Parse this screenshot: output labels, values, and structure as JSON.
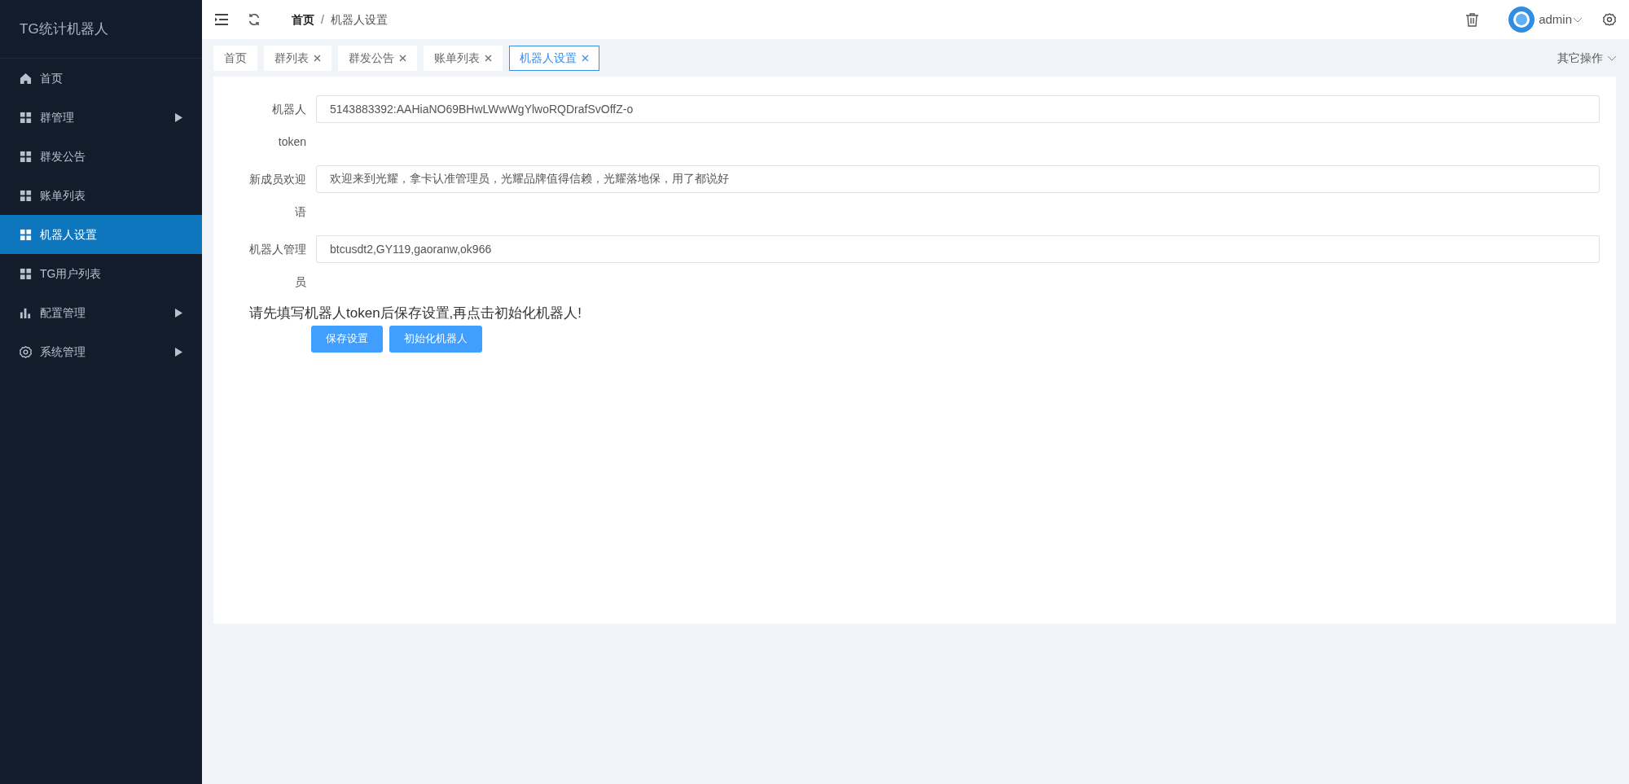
{
  "sidebar": {
    "title": "TG统计机器人",
    "items": [
      {
        "label": "首页",
        "kind": "home",
        "selected": false,
        "has_submenu": false
      },
      {
        "label": "群管理",
        "kind": "grid",
        "selected": false,
        "has_submenu": true
      },
      {
        "label": "群发公告",
        "kind": "grid",
        "selected": false,
        "has_submenu": false
      },
      {
        "label": "账单列表",
        "kind": "grid",
        "selected": false,
        "has_submenu": false
      },
      {
        "label": "机器人设置",
        "kind": "grid",
        "selected": true,
        "has_submenu": false
      },
      {
        "label": "TG用户列表",
        "kind": "grid",
        "selected": false,
        "has_submenu": false
      },
      {
        "label": "配置管理",
        "kind": "chart",
        "selected": false,
        "has_submenu": true
      },
      {
        "label": "系统管理",
        "kind": "gear",
        "selected": false,
        "has_submenu": true
      }
    ]
  },
  "header": {
    "breadcrumb": [
      "首页",
      "机器人设置"
    ],
    "breadcrumb_separator": "/",
    "user": "admin"
  },
  "tabs": [
    {
      "label": "首页",
      "closable": false,
      "selected": false
    },
    {
      "label": "群列表",
      "closable": true,
      "selected": false
    },
    {
      "label": "群发公告",
      "closable": true,
      "selected": false
    },
    {
      "label": "账单列表",
      "closable": true,
      "selected": false
    },
    {
      "label": "机器人设置",
      "closable": true,
      "selected": true
    }
  ],
  "tab_actions": "其它操作",
  "form": {
    "fields": [
      {
        "label": "机器人token",
        "value": "5143883392:AAHiaNO69BHwLWwWgYlwoRQDrafSvOffZ-o"
      },
      {
        "label": "新成员欢迎语",
        "value": "欢迎来到光耀，拿卡认准管理员，光耀品牌值得信赖，光耀落地保，用了都说好"
      },
      {
        "label": "机器人管理员",
        "value": "btcusdt2,GY119,gaoranw,ok966"
      }
    ],
    "notice": "请先填写机器人token后保存设置,再点击初始化机器人!",
    "buttons": [
      "保存设置",
      "初始化机器人"
    ]
  }
}
